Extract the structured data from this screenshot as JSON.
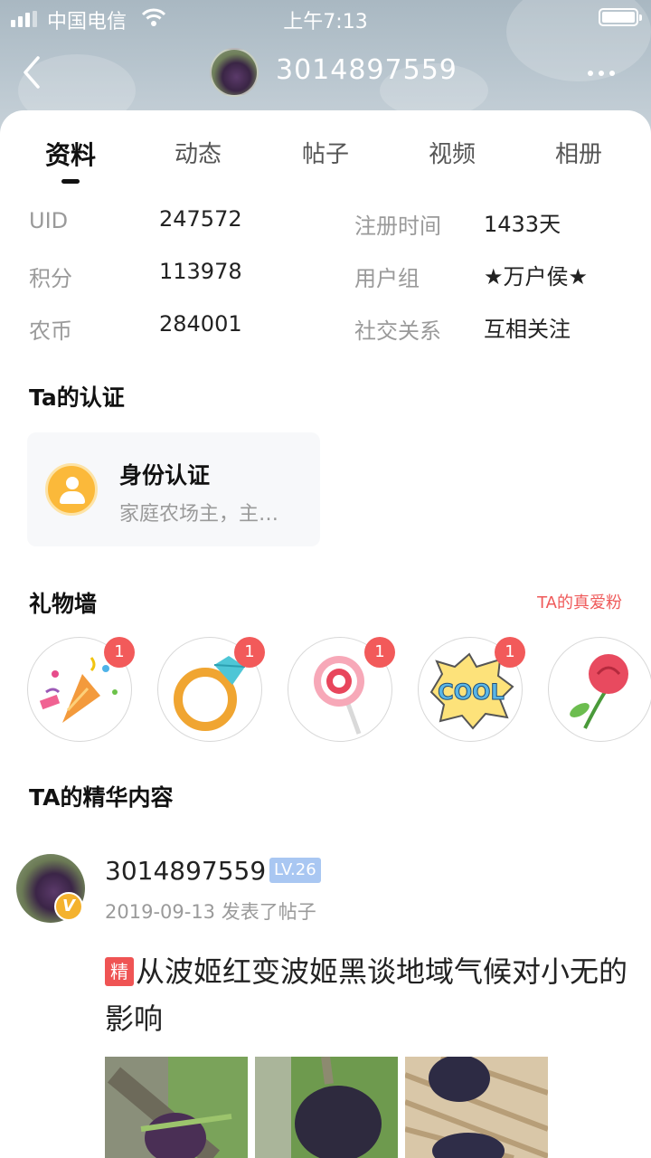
{
  "status_bar": {
    "carrier": "中国电信",
    "time": "上午7:13"
  },
  "header": {
    "title": "3014897559"
  },
  "tabs": [
    {
      "label": "资料",
      "active": true
    },
    {
      "label": "动态",
      "active": false
    },
    {
      "label": "帖子",
      "active": false
    },
    {
      "label": "视频",
      "active": false
    },
    {
      "label": "相册",
      "active": false
    }
  ],
  "profile": {
    "uid_label": "UID",
    "uid_value": "247572",
    "reg_label": "注册时间",
    "reg_value": "1433天",
    "points_label": "积分",
    "points_value": "113978",
    "group_label": "用户组",
    "group_value": "★万户侯★",
    "coins_label": "农币",
    "coins_value": "284001",
    "social_label": "社交关系",
    "social_value": "互相关注"
  },
  "certification": {
    "section_title": "Ta的认证",
    "title": "身份认证",
    "description": "家庭农场主，主…"
  },
  "gift_wall": {
    "section_title": "礼物墙",
    "fans_link": "TA的真爱粉",
    "gifts": [
      {
        "icon": "party-popper-icon",
        "count": "1"
      },
      {
        "icon": "diamond-ring-icon",
        "count": "1"
      },
      {
        "icon": "lollipop-icon",
        "count": "1"
      },
      {
        "icon": "cool-sticker-icon",
        "count": "1"
      },
      {
        "icon": "rose-icon",
        "count": ""
      }
    ]
  },
  "featured": {
    "section_title": "TA的精华内容",
    "post": {
      "author": "3014897559",
      "level": "LV.26",
      "meta": "2019-09-13 发表了帖子",
      "tag": "精",
      "title": "从波姬红变波姬黑谈地域气候对小无的影响"
    }
  },
  "colors": {
    "accent_red": "#ef5454",
    "level_blue": "#a9c7f2",
    "vip_gold": "#f4b22e"
  }
}
